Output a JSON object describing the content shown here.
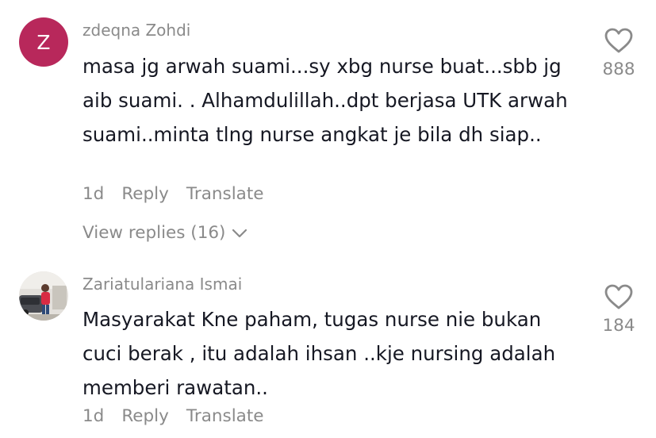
{
  "comments": [
    {
      "avatar_letter": "Z",
      "username": "zdeqna Zohdi",
      "text": "masa jg arwah suami...sy xbg nurse buat...sbb jg aib suami. . Alhamdulillah..dpt berjasa UTK arwah suami..minta tlng nurse angkat je bila dh siap..",
      "time": "1d",
      "reply_label": "Reply",
      "translate_label": "Translate",
      "view_replies_label": "View replies (16)",
      "likes": "888"
    },
    {
      "username": "Zariatulariana Ismai",
      "text": "Masyarakat Kne paham, tugas nurse nie bukan cuci berak , itu adalah ihsan ..kje nursing adalah memberi rawatan..",
      "time": "1d",
      "reply_label": "Reply",
      "translate_label": "Translate",
      "likes": "184"
    }
  ],
  "colors": {
    "avatar_bg": "#b8285b",
    "text_primary": "#161823",
    "text_secondary": "#8a8a8a"
  }
}
